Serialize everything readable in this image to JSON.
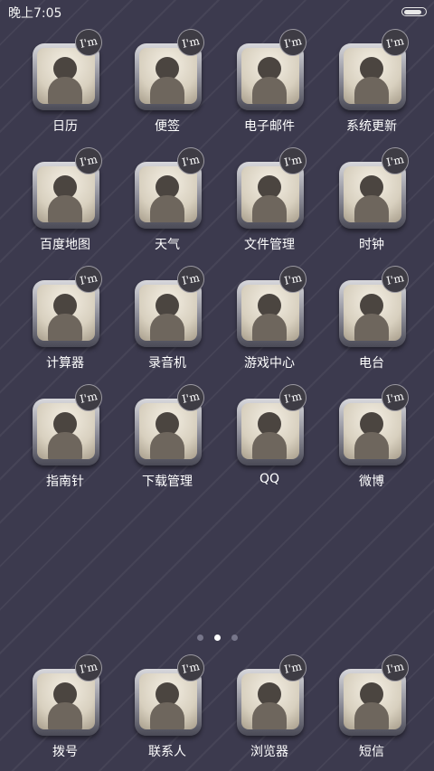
{
  "status_bar": {
    "time": "晚上7:05",
    "battery_level": 0.9
  },
  "badge_text": "I'm",
  "apps": [
    {
      "label": "日历",
      "icon": "calendar-icon"
    },
    {
      "label": "便签",
      "icon": "notes-icon"
    },
    {
      "label": "电子邮件",
      "icon": "email-icon"
    },
    {
      "label": "系统更新",
      "icon": "system-update-icon"
    },
    {
      "label": "百度地图",
      "icon": "baidu-map-icon"
    },
    {
      "label": "天气",
      "icon": "weather-icon"
    },
    {
      "label": "文件管理",
      "icon": "file-manager-icon"
    },
    {
      "label": "时钟",
      "icon": "clock-icon"
    },
    {
      "label": "计算器",
      "icon": "calculator-icon"
    },
    {
      "label": "录音机",
      "icon": "recorder-icon"
    },
    {
      "label": "游戏中心",
      "icon": "game-center-icon"
    },
    {
      "label": "电台",
      "icon": "radio-icon"
    },
    {
      "label": "指南针",
      "icon": "compass-icon"
    },
    {
      "label": "下载管理",
      "icon": "download-manager-icon"
    },
    {
      "label": "QQ",
      "icon": "qq-icon"
    },
    {
      "label": "微博",
      "icon": "weibo-icon"
    }
  ],
  "page_indicator": {
    "count": 3,
    "active": 1
  },
  "dock": [
    {
      "label": "拨号",
      "icon": "phone-dialer-icon"
    },
    {
      "label": "联系人",
      "icon": "contacts-icon"
    },
    {
      "label": "浏览器",
      "icon": "browser-icon"
    },
    {
      "label": "短信",
      "icon": "messages-icon"
    }
  ]
}
